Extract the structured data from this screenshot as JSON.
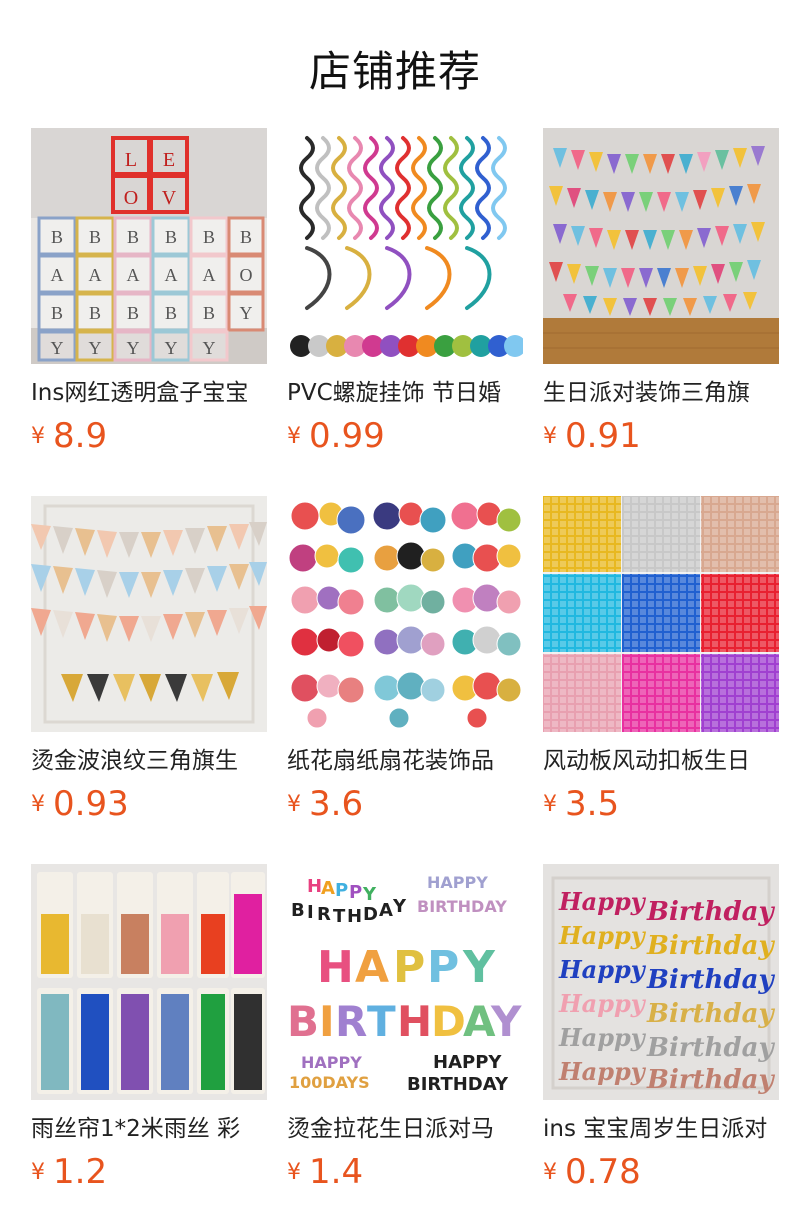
{
  "header": {
    "title": "店铺推荐"
  },
  "currency": "¥",
  "products": [
    {
      "name": "Ins网红透明盒子宝宝",
      "price": "8.9",
      "thumb_icon": "letter-boxes-image"
    },
    {
      "name": "PVC螺旋挂饰 节日婚",
      "price": "0.99",
      "thumb_icon": "spiral-hangings-image"
    },
    {
      "name": "生日派对装饰三角旗",
      "price": "0.91",
      "thumb_icon": "pennant-banners-image"
    },
    {
      "name": "烫金波浪纹三角旗生",
      "price": "0.93",
      "thumb_icon": "gold-wave-pennants-image"
    },
    {
      "name": "纸花扇纸扇花装饰品",
      "price": "3.6",
      "thumb_icon": "paper-fans-image"
    },
    {
      "name": "风动板风动扣板生日",
      "price": "3.5",
      "thumb_icon": "sequin-panels-image"
    },
    {
      "name": "雨丝帘1*2米雨丝 彩",
      "price": "1.2",
      "thumb_icon": "foil-curtains-image"
    },
    {
      "name": "烫金拉花生日派对马",
      "price": "1.4",
      "thumb_icon": "happy-birthday-banner-image"
    },
    {
      "name": "ins 宝宝周岁生日派对",
      "price": "0.78",
      "thumb_icon": "happy-birthday-script-image"
    }
  ]
}
